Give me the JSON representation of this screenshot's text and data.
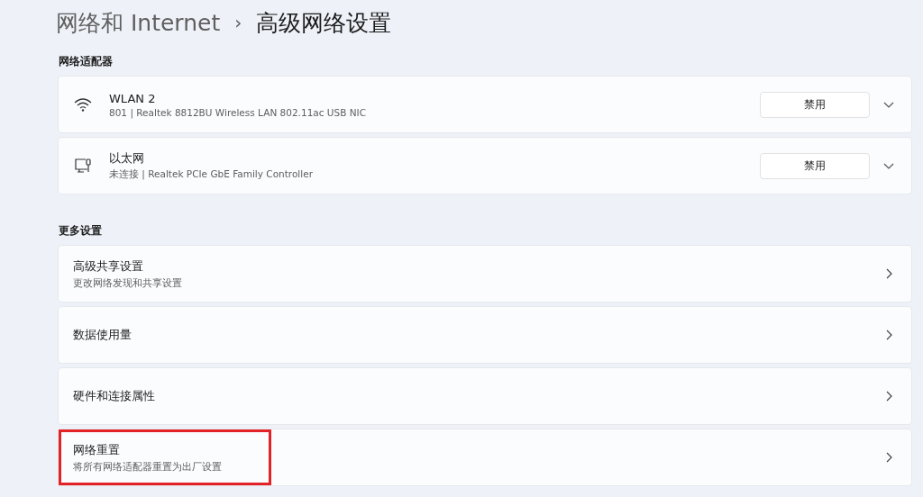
{
  "breadcrumb": {
    "parent": "网络和 Internet",
    "separator": "›",
    "current": "高级网络设置"
  },
  "adapters_section": {
    "title": "网络适配器",
    "items": [
      {
        "kind": "wifi",
        "name": "WLAN 2",
        "description": "801 | Realtek 8812BU Wireless LAN 802.11ac USB NIC",
        "button": "禁用",
        "expanded": false
      },
      {
        "kind": "ethernet",
        "name": "以太网",
        "description": "未连接 | Realtek PCIe GbE Family Controller",
        "button": "禁用",
        "expanded": false
      }
    ]
  },
  "more_section": {
    "title": "更多设置",
    "items": [
      {
        "title": "高级共享设置",
        "description": "更改网络发现和共享设置",
        "highlighted": false
      },
      {
        "title": "数据使用量",
        "highlighted": false
      },
      {
        "title": "硬件和连接属性",
        "highlighted": false
      },
      {
        "title": "网络重置",
        "description": "将所有网络适配器重置为出厂设置",
        "highlighted": true
      }
    ]
  }
}
